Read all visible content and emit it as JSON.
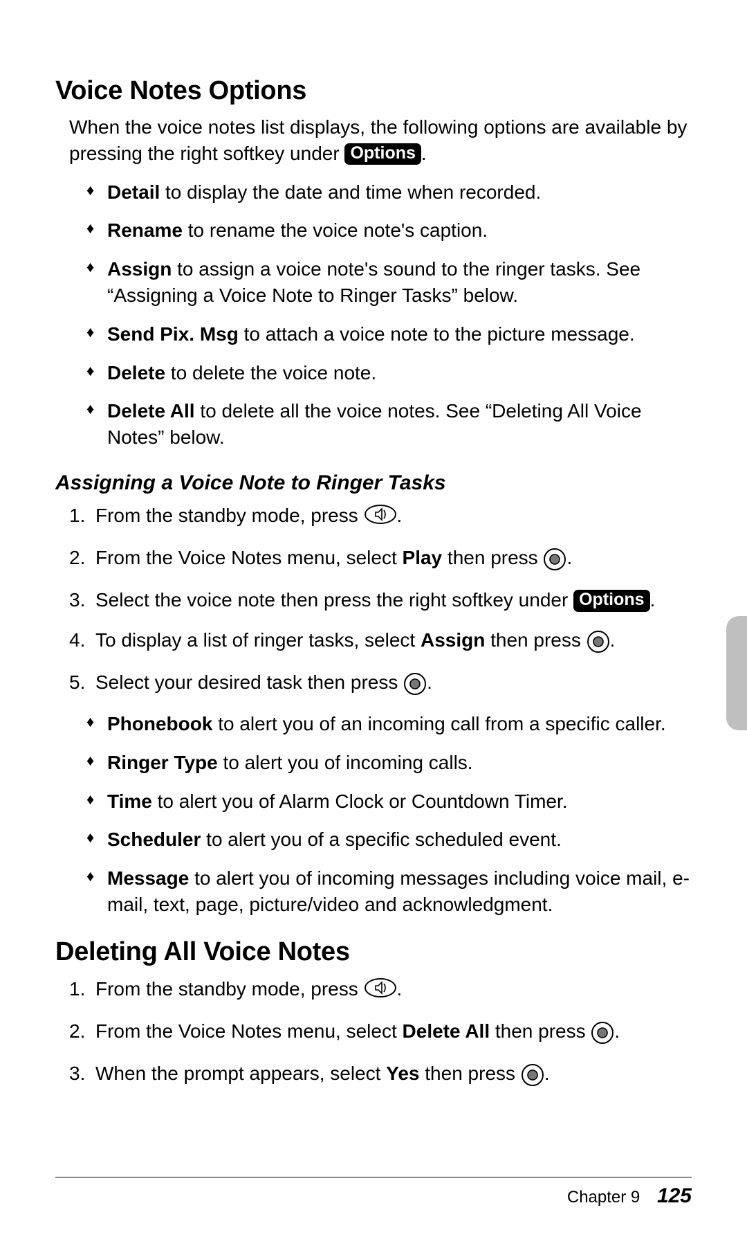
{
  "section1": {
    "heading": "Voice Notes Options",
    "intro_a": "When the voice notes list displays, the following options are avail­able by pressing the right softkey under ",
    "intro_badge": "Options",
    "intro_b": ".",
    "options": [
      {
        "term": "Detail",
        "desc": " to display the date and time when recorded."
      },
      {
        "term": "Rename",
        "desc": " to rename the voice note's caption."
      },
      {
        "term": "Assign",
        "desc": " to assign a voice note's sound to the ringer tasks. See “Assigning a Voice Note to Ringer Tasks” below."
      },
      {
        "term": "Send Pix. Msg",
        "desc": " to attach a voice note to the picture message."
      },
      {
        "term": "Delete",
        "desc": " to delete the voice note."
      },
      {
        "term": "Delete All",
        "desc": " to delete all the voice notes. See “Deleting All Voice Notes” below."
      }
    ]
  },
  "subsection": {
    "heading": "Assigning a Voice Note to Ringer Tasks",
    "steps": {
      "s1a": "From the standby mode, press ",
      "s2a": "From the Voice Notes menu, select ",
      "s2b": "Play",
      "s2c": " then press ",
      "s3a": "Select the voice note then press the right softkey under ",
      "s3badge": "Options",
      "s4a": "To display a list of ringer tasks, select ",
      "s4b": "Assign",
      "s4c": " then press ",
      "s5a": "Select your desired task then press "
    },
    "tasks": [
      {
        "term": "Phonebook",
        "desc": " to alert you of an incoming call from a specific caller."
      },
      {
        "term": "Ringer Type",
        "desc": " to alert you of incoming calls."
      },
      {
        "term": "Time",
        "desc": " to alert you of Alarm Clock or Countdown Timer."
      },
      {
        "term": "Scheduler",
        "desc": " to alert you of a specific scheduled event."
      },
      {
        "term": "Message",
        "desc": " to alert you of incoming messages including voice mail, e-mail, text, page, picture/video and acknowledgment."
      }
    ]
  },
  "section2": {
    "heading": "Deleting All Voice Notes",
    "s1a": "From the standby mode, press ",
    "s2a": "From the Voice Notes menu, select ",
    "s2b": "Delete All",
    "s2c": " then press ",
    "s3a": "When the prompt appears, select ",
    "s3b": "Yes",
    "s3c": " then press "
  },
  "footer": {
    "chapter": "Chapter 9",
    "page": "125"
  },
  "period": "."
}
